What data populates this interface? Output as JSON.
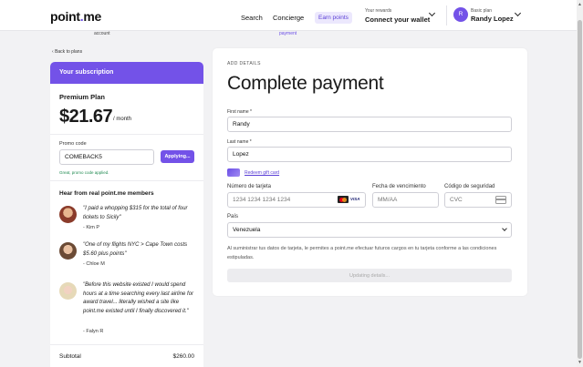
{
  "header": {
    "logo_text": "point",
    "logo_dot": ".",
    "logo_suffix": "me",
    "nav": {
      "search": "Search",
      "concierge": "Concierge",
      "earn_points": "Earn points"
    },
    "rewards_label": "Your rewards",
    "rewards_value": "Connect your wallet",
    "user_initial": "R",
    "user_plan": "Basic plan",
    "user_name": "Randy Lopez"
  },
  "steps": {
    "account": "account",
    "payment": "payment"
  },
  "back_link": "Back to plans",
  "subscription": {
    "header": "Your subscription",
    "plan_name": "Premium Plan",
    "price": "$21.67",
    "period": "/ month",
    "promo_label": "Promo code",
    "promo_value": "COMEBACK5",
    "promo_button": "Applying...",
    "promo_success": "Great, promo code applied.",
    "testimonials_heading": "Hear from real point.me members",
    "testimonials": [
      {
        "quote": "\"I paid a whopping $315 for the total of four tickets to Sicily\"",
        "name": "- Kim P"
      },
      {
        "quote": "\"One of my flights NYC > Cape Town costs $5.60 plus points\"",
        "name": "- Chloe M"
      },
      {
        "quote": "\"Before this website existed I would spend hours at a time searching every last airline for award travel... literally wished a site like point.me existed until I finally discovered it.\"",
        "name": "- Falyn R"
      }
    ],
    "subtotal_label": "Subtotal",
    "subtotal_value": "$260.00"
  },
  "payment": {
    "section_label": "ADD DETAILS",
    "title": "Complete payment",
    "first_name_label": "First name *",
    "first_name_value": "Randy",
    "last_name_label": "Last name *",
    "last_name_value": "Lopez",
    "gift_card_link": "Redeem gift card",
    "card_number_label": "Número de tarjeta",
    "card_number_placeholder": "1234 1234 1234 1234",
    "expiry_label": "Fecha de vencimiento",
    "expiry_placeholder": "MM/AA",
    "cvc_label": "Código de seguridad",
    "cvc_placeholder": "CVC",
    "country_label": "País",
    "country_value": "Venezuela",
    "disclaimer": "Al suministrar tus datos de tarjeta, le permites a point.me efectuar futuros cargos en tu tarjeta conforme a las condiciones estipuladas.",
    "submit_label": "Updating details...",
    "card_brand_visa": "VISA"
  },
  "colors": {
    "accent": "#7352e8",
    "success": "#1f8a50"
  }
}
